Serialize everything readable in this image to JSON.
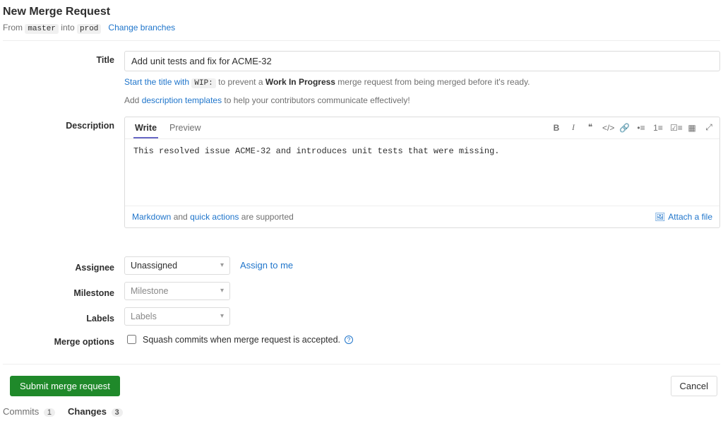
{
  "header": {
    "title": "New Merge Request",
    "from_label": "From",
    "source_branch": "master",
    "into_label": "into",
    "target_branch": "prod",
    "change_branches": "Change branches"
  },
  "field_labels": {
    "title": "Title",
    "description": "Description",
    "assignee": "Assignee",
    "milestone": "Milestone",
    "labels": "Labels",
    "merge_options": "Merge options"
  },
  "title_field": {
    "value": "Add unit tests and fix for ACME-32",
    "hint_prefix1": "Start the title with ",
    "wip_code": "WIP:",
    "hint_prefix2": " to prevent a ",
    "hint_bold": "Work In Progress",
    "hint_suffix": " merge request from being merged before it's ready.",
    "hint2_prefix": "Add ",
    "hint2_link": "description templates",
    "hint2_suffix": " to help your contributors communicate effectively!"
  },
  "editor": {
    "tabs": {
      "write": "Write",
      "preview": "Preview"
    },
    "body": "This resolved issue ACME-32 and introduces unit tests that were missing.",
    "footer_link1": "Markdown",
    "footer_and": " and ",
    "footer_link2": "quick actions",
    "footer_suffix": " are supported",
    "attach": "Attach a file"
  },
  "assignee": {
    "value": "Unassigned",
    "assign_to_me": "Assign to me"
  },
  "milestone": {
    "placeholder": "Milestone"
  },
  "labels": {
    "placeholder": "Labels"
  },
  "merge_options": {
    "squash": "Squash commits when merge request is accepted."
  },
  "actions": {
    "submit": "Submit merge request",
    "cancel": "Cancel"
  },
  "bottom_tabs": {
    "commits_label": "Commits",
    "commits_count": "1",
    "changes_label": "Changes",
    "changes_count": "3"
  }
}
